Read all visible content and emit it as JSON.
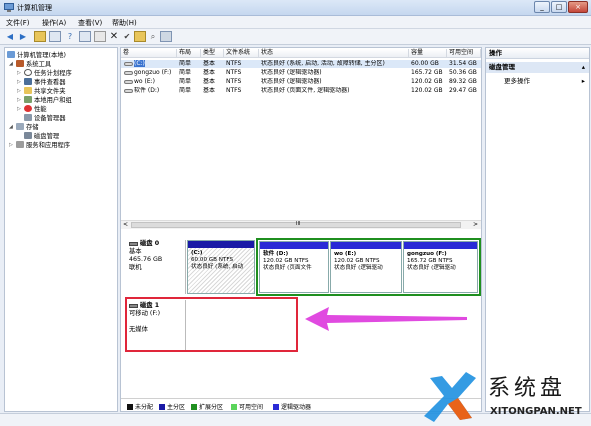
{
  "window": {
    "title": "计算机管理",
    "min": "_",
    "max": "□",
    "close": "×"
  },
  "menu": [
    "文件(F)",
    "操作(A)",
    "查看(V)",
    "帮助(H)"
  ],
  "tree": {
    "root": "计算机管理(本地)",
    "system_tools": "系统工具",
    "task_scheduler": "任务计划程序",
    "event_viewer": "事件查看器",
    "shared_folders": "共享文件夹",
    "local_users": "本地用户和组",
    "performance": "性能",
    "device_manager": "设备管理器",
    "storage": "存储",
    "disk_management": "磁盘管理",
    "services": "服务和应用程序"
  },
  "volumes": {
    "headers": [
      "卷",
      "布局",
      "类型",
      "文件系统",
      "状态",
      "容量",
      "可用空间"
    ],
    "rows": [
      [
        "(C:)",
        "简单",
        "基本",
        "NTFS",
        "状态良好 (系统, 启动, 活动, 故障转储, 主分区)",
        "60.00 GB",
        "31.54 GB"
      ],
      [
        "gongzuo (F:)",
        "简单",
        "基本",
        "NTFS",
        "状态良好 (逻辑驱动器)",
        "165.72 GB",
        "50.36 GB"
      ],
      [
        "wo (E:)",
        "简单",
        "基本",
        "NTFS",
        "状态良好 (逻辑驱动器)",
        "120.02 GB",
        "89.32 GB"
      ],
      [
        "软件 (D:)",
        "简单",
        "基本",
        "NTFS",
        "状态良好 (页面文件, 逻辑驱动器)",
        "120.02 GB",
        "29.47 GB"
      ]
    ]
  },
  "scroll": {
    "left": "<",
    "right": ">",
    "grip": "III"
  },
  "disk0": {
    "name": "磁盘 0",
    "type": "基本",
    "size": "465.76 GB",
    "status": "联机",
    "parts": [
      {
        "name": "(C:)",
        "size": "60.00 GB NTFS",
        "status": "状态良好 (系统, 启动"
      },
      {
        "name": "软件 (D:)",
        "size": "120.02 GB NTFS",
        "status": "状态良好 (页面文件"
      },
      {
        "name": "wo (E:)",
        "size": "120.02 GB NTFS",
        "status": "状态良好 (逻辑驱动"
      },
      {
        "name": "gongzuo (F:)",
        "size": "165.72 GB NTFS",
        "status": "状态良好 (逻辑驱动"
      }
    ]
  },
  "disk1": {
    "name": "磁盘 1",
    "type": "可移动 (F:)",
    "media": "无媒体"
  },
  "legend": [
    {
      "label": "未分配",
      "color": "#111111"
    },
    {
      "label": "主分区",
      "color": "#1a1aa6"
    },
    {
      "label": "扩展分区",
      "color": "#1f8f1f"
    },
    {
      "label": "可用空间",
      "color": "#5bd45b"
    },
    {
      "label": "逻辑驱动器",
      "color": "#2a2ad6"
    }
  ],
  "actions": {
    "header": "操作",
    "section": "磁盘管理",
    "more": "更多操作"
  },
  "watermark": {
    "cn": "系统盘",
    "url": "XITONGPAN.NET"
  },
  "colors": {
    "highlight_border": "#e0263a",
    "arrow": "#e04ae0",
    "extended_border": "#1f8f1f"
  }
}
